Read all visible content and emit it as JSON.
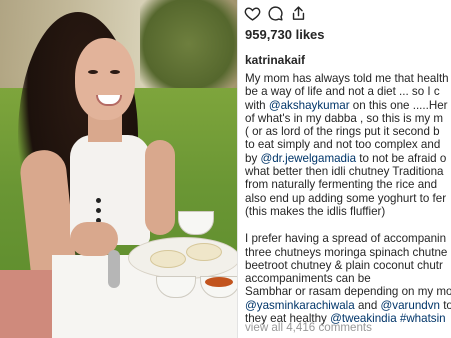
{
  "photo": {
    "alt_subject": "woman-eating-breakfast"
  },
  "post": {
    "likes": "959,730 likes",
    "username": "katrinakaif",
    "caption_lines_1": [
      [
        {
          "t": "My mom has always told me that health"
        }
      ],
      [
        {
          "t": "be a way of life and not a diet ... so I c"
        }
      ],
      [
        {
          "t": "with "
        },
        {
          "t": "@akshaykumar",
          "m": true
        },
        {
          "t": " on this one .....Her"
        }
      ],
      [
        {
          "t": "of what's in my dabba , so this is my m"
        }
      ],
      [
        {
          "t": "( or as lord of the rings put it second b"
        }
      ],
      [
        {
          "t": "to eat simply and not too complex and"
        }
      ],
      [
        {
          "t": "by "
        },
        {
          "t": "@dr.jewelgamadia",
          "m": true
        },
        {
          "t": " to not be afraid o"
        }
      ],
      [
        {
          "t": "what better then idli chutney Traditiona"
        }
      ],
      [
        {
          "t": "from naturally fermenting the rice and "
        }
      ],
      [
        {
          "t": "also end up adding some yoghurt to fer"
        }
      ],
      [
        {
          "t": "(this makes the idlis fluffier)"
        }
      ]
    ],
    "caption_lines_2": [
      [
        {
          "t": "I prefer having a spread of accompanin"
        }
      ],
      [
        {
          "t": "three chutneys moringa spinach chutne"
        }
      ],
      [
        {
          "t": "beetroot chutney & plain coconut chutr"
        }
      ],
      [
        {
          "t": "accompaniments can be"
        }
      ],
      [
        {
          "t": "Sambhar or rasam depending on my mo"
        }
      ],
      [
        {
          "t": "@yasminkarachiwala",
          "m": true
        },
        {
          "t": " and "
        },
        {
          "t": "@varundvn",
          "m": true
        },
        {
          "t": " to"
        }
      ],
      [
        {
          "t": "they eat healthy "
        },
        {
          "t": "@tweakindia #whatsin",
          "m": true
        }
      ]
    ],
    "view_comments": "view all 4,416 comments"
  },
  "icons": [
    "heart-icon",
    "comment-icon",
    "share-icon"
  ],
  "colors": {
    "text": "#262626",
    "mention": "#003569",
    "muted": "#999999"
  }
}
